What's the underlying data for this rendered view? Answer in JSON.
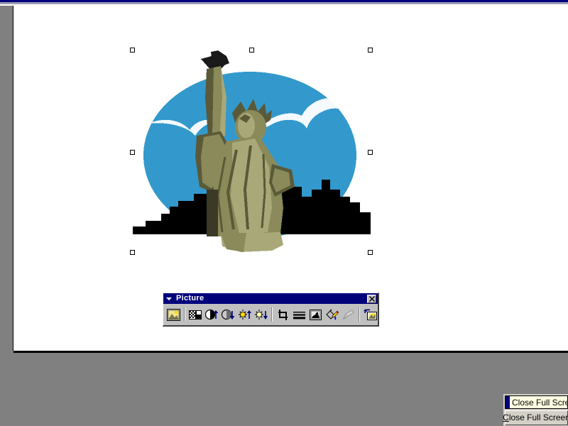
{
  "app": {
    "mode": "slide-show-full-screen-edit",
    "background_color": "#808080",
    "slide_background": "#ffffff",
    "chrome_accent": "#00007b"
  },
  "slide": {
    "picture": {
      "alt": "Statue of Liberty clipart with blue oval sky, white clouds and black city skyline",
      "colors": {
        "sky": "#3399cc",
        "statue_light": "#a8a878",
        "statue_mid": "#8a8a5a",
        "statue_dark": "#5a5a38",
        "skyline": "#000000",
        "cloud": "#ffffff"
      },
      "selected": true,
      "handle_count": 8
    }
  },
  "picture_toolbar": {
    "title": "Picture",
    "close_label": "×",
    "menu_arrow": "chevron-down",
    "buttons": [
      {
        "id": "insert-picture",
        "label": "Insert Picture"
      },
      {
        "id": "image-control",
        "label": "Color"
      },
      {
        "id": "more-contrast",
        "label": "More Contrast"
      },
      {
        "id": "less-contrast",
        "label": "Less Contrast"
      },
      {
        "id": "more-brightness",
        "label": "More Brightness"
      },
      {
        "id": "less-brightness",
        "label": "Less Brightness"
      },
      {
        "id": "crop",
        "label": "Crop"
      },
      {
        "id": "line-style",
        "label": "Line Style"
      },
      {
        "id": "recolor-picture",
        "label": "Recolor Picture"
      },
      {
        "id": "format-picture",
        "label": "Format Picture"
      },
      {
        "id": "set-transparent-color",
        "label": "Set Transparent Color"
      },
      {
        "id": "reset-picture",
        "label": "Reset Picture"
      }
    ]
  },
  "close_full_screen": {
    "popup_label": "Close Full Screen",
    "button_label_before": "C",
    "button_label_after": "lose Full Screen",
    "button_label_full": "Close Full Screen"
  }
}
